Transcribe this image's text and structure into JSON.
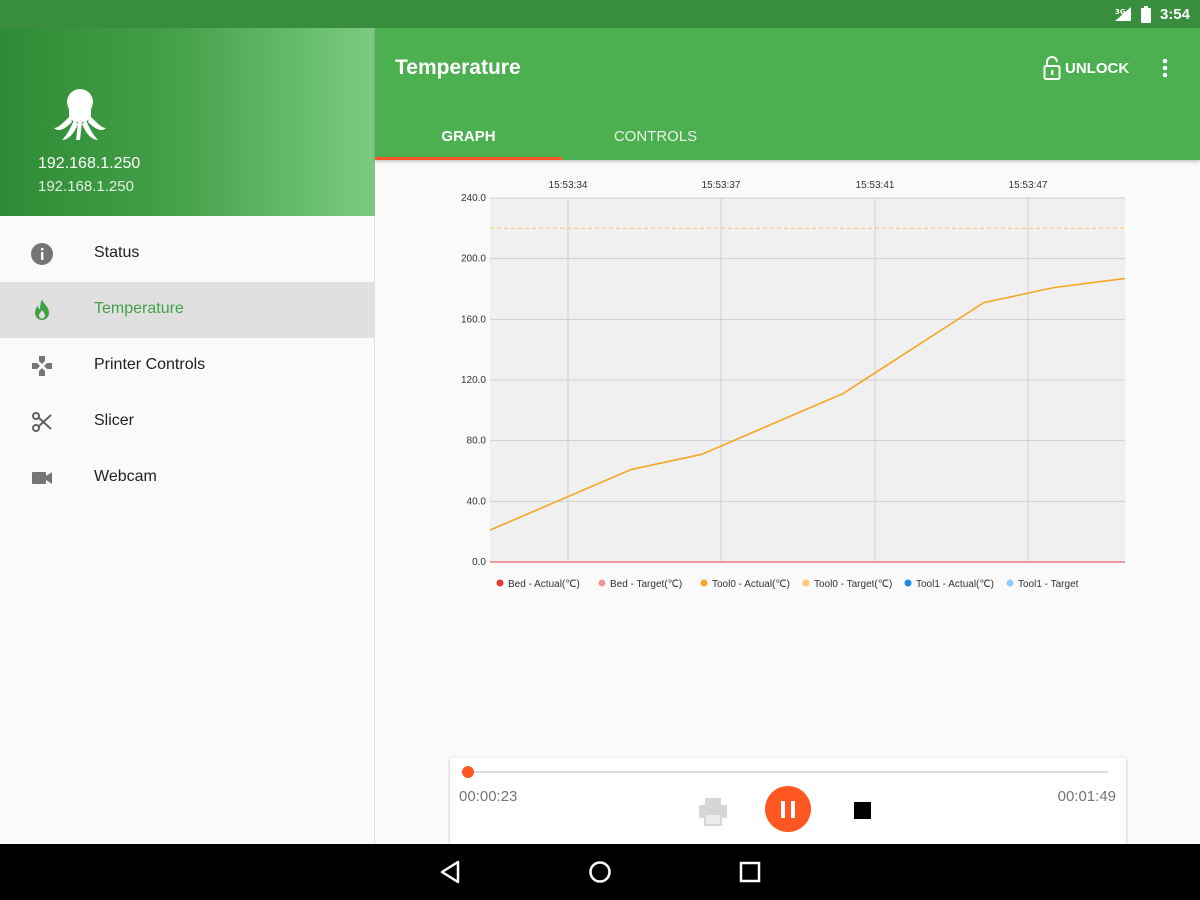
{
  "status_bar": {
    "time": "3:54"
  },
  "drawer": {
    "host_primary": "192.168.1.250",
    "host_secondary": "192.168.1.250",
    "items": [
      {
        "label": "Status",
        "icon": "info-icon"
      },
      {
        "label": "Temperature",
        "icon": "flame-icon",
        "active": true
      },
      {
        "label": "Printer Controls",
        "icon": "dpad-icon"
      },
      {
        "label": "Slicer",
        "icon": "scissors-icon"
      },
      {
        "label": "Webcam",
        "icon": "videocam-icon"
      }
    ]
  },
  "app_bar": {
    "title": "Temperature",
    "unlock_label": "UNLOCK",
    "tabs": [
      {
        "label": "GRAPH",
        "active": true
      },
      {
        "label": "CONTROLS"
      }
    ]
  },
  "colors": {
    "primary": "#4caf50",
    "primary_dark": "#388e3c",
    "accent": "#ff5722",
    "tool0_actual": "#f5a623",
    "tool0_target": "#ffc77a",
    "bed_actual": "#e53935",
    "bed_target": "#ef9a9a",
    "tool1_actual": "#1e88e5",
    "tool1_target": "#90caf9"
  },
  "chart_data": {
    "type": "line",
    "x_ticks": [
      "15:53:34",
      "15:53:37",
      "15:53:41",
      "15:53:47"
    ],
    "y_ticks": [
      "0.0",
      "40.0",
      "80.0",
      "120.0",
      "160.0",
      "200.0",
      "240.0"
    ],
    "ylim": [
      0,
      240
    ],
    "grid": true,
    "legend_position": "bottom",
    "series": [
      {
        "name": "Bed - Actual(℃)",
        "color": "#e53935",
        "values": [
          0,
          0,
          0,
          0,
          0,
          0,
          0,
          0,
          0
        ]
      },
      {
        "name": "Bed - Target(℃)",
        "color": "#ef9a9a",
        "values": [
          0,
          0,
          0,
          0,
          0,
          0,
          0,
          0,
          0
        ]
      },
      {
        "name": "Tool0 - Actual(℃)",
        "color": "#f5a623",
        "values": [
          21,
          41,
          61,
          71,
          91,
          111,
          141,
          171,
          181,
          187
        ]
      },
      {
        "name": "Tool0 - Target(℃)",
        "color": "#ffc77a",
        "dashed": true,
        "values": [
          220,
          220
        ]
      },
      {
        "name": "Tool1 - Actual(℃)",
        "color": "#1e88e5",
        "values": []
      },
      {
        "name": "Tool1 - Target",
        "color": "#90caf9",
        "values": []
      }
    ]
  },
  "player": {
    "elapsed": "00:00:23",
    "total": "00:01:49",
    "progress": 0.0
  }
}
